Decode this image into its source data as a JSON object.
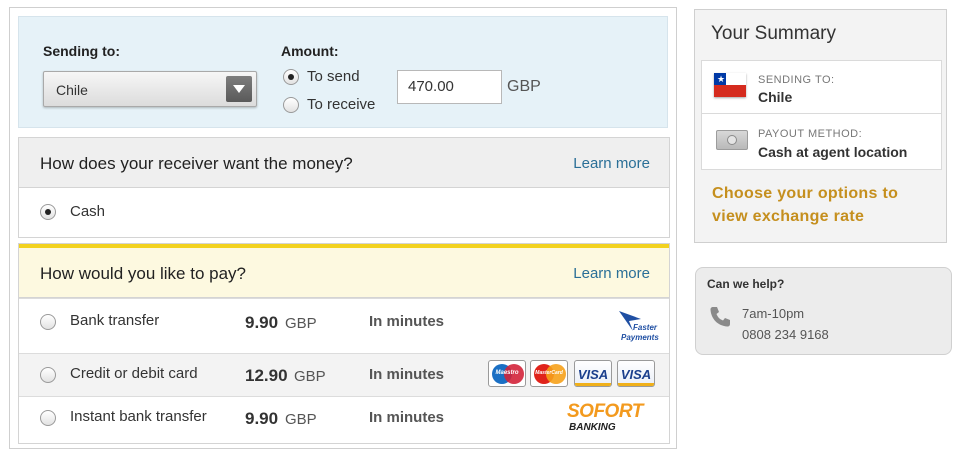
{
  "sending": {
    "label": "Sending to:",
    "country": "Chile"
  },
  "amount": {
    "label": "Amount:",
    "option_send": "To send",
    "option_receive": "To receive",
    "value": "470.00",
    "currency": "GBP",
    "selected": "send"
  },
  "receive": {
    "title": "How does your receiver want the money?",
    "learn_more": "Learn more",
    "options": [
      {
        "label": "Cash",
        "selected": true
      }
    ]
  },
  "pay": {
    "title": "How would you like to pay?",
    "learn_more": "Learn more",
    "options": [
      {
        "label": "Bank transfer",
        "fee": "9.90",
        "currency": "GBP",
        "speed": "In minutes",
        "logo": "faster-payments"
      },
      {
        "label": "Credit or debit card",
        "fee": "12.90",
        "currency": "GBP",
        "speed": "In minutes",
        "logo": "cards"
      },
      {
        "label": "Instant bank transfer",
        "fee": "9.90",
        "currency": "GBP",
        "speed": "In minutes",
        "logo": "sofort"
      }
    ],
    "logos": {
      "faster_1": "Faster",
      "faster_2": "Payments",
      "maestro": "Maestro",
      "mastercard": "MasterCard",
      "visa_credit": "VISA",
      "visa_debit": "VISA",
      "sofort_1": "SOFORT",
      "sofort_2": "BANKING"
    }
  },
  "summary": {
    "title": "Your Summary",
    "sending_label": "SENDING TO:",
    "sending_value": "Chile",
    "payout_label": "PAYOUT METHOD:",
    "payout_value": "Cash at agent location",
    "prompt": "Choose your options to view exchange rate"
  },
  "help": {
    "title": "Can we help?",
    "hours": "7am-10pm",
    "phone": "0808 234 9168"
  },
  "colors": {
    "accent_link": "#2a6f97",
    "highlight": "#f2d21f",
    "prompt_gold": "#c58f1e",
    "panel_blue": "#e6f2f8"
  }
}
